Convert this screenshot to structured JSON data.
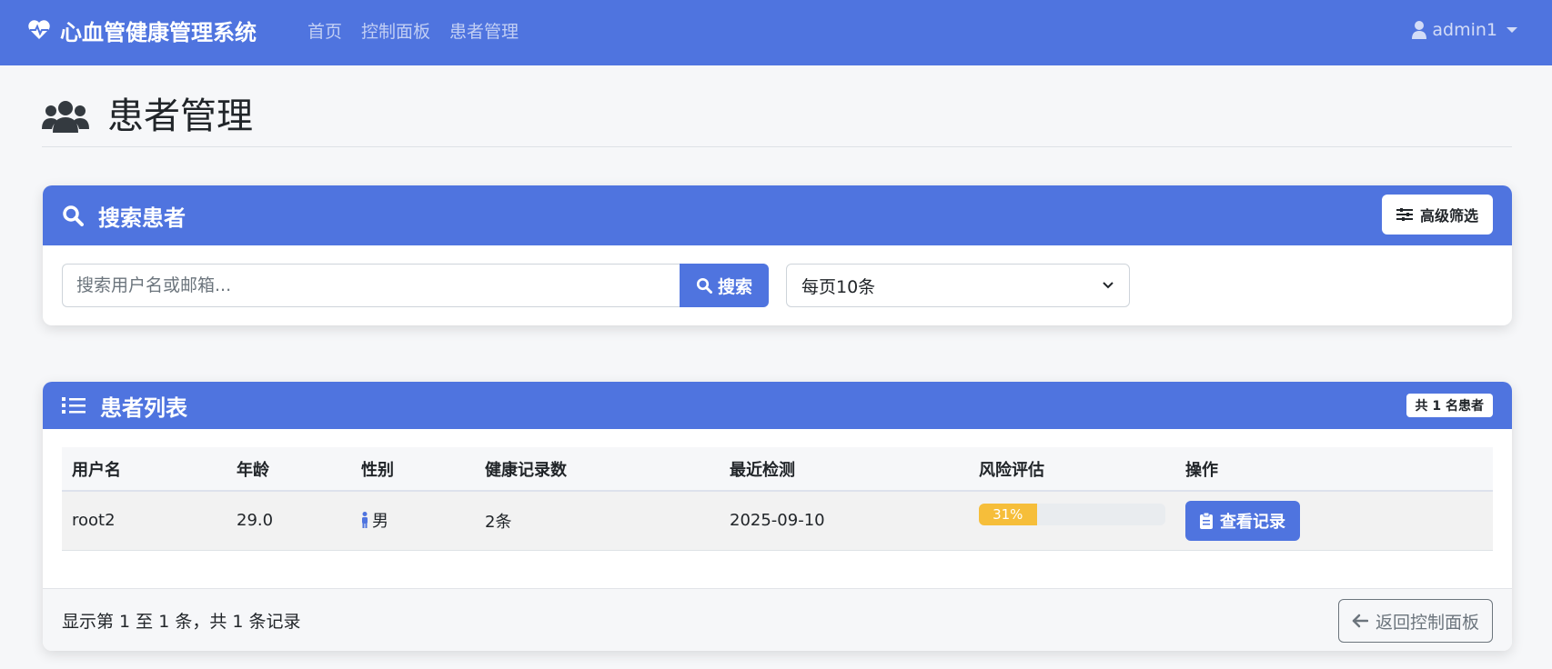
{
  "navbar": {
    "brand": "心血管健康管理系统",
    "links": [
      "首页",
      "控制面板",
      "患者管理"
    ],
    "user": "admin1"
  },
  "page": {
    "title": "患者管理"
  },
  "search": {
    "title": "搜索患者",
    "advanced_label": "高级筛选",
    "placeholder": "搜索用户名或邮箱...",
    "button_label": "搜索",
    "per_page": "每页10条"
  },
  "list": {
    "title": "患者列表",
    "count_badge": "共 1 名患者",
    "columns": [
      "用户名",
      "年龄",
      "性别",
      "健康记录数",
      "最近检测",
      "风险评估",
      "操作"
    ],
    "rows": [
      {
        "username": "root2",
        "age": "29.0",
        "gender": "男",
        "records": "2条",
        "last_check": "2025-09-10",
        "risk_label": "31%",
        "risk_value": 31,
        "action": "查看记录"
      }
    ],
    "footer_info": "显示第 1 至 1 条，共 1 条记录",
    "back_label": "返回控制面板"
  },
  "colors": {
    "primary": "#4f74df",
    "warning": "#f6be3a",
    "secondary": "#6c757d"
  }
}
